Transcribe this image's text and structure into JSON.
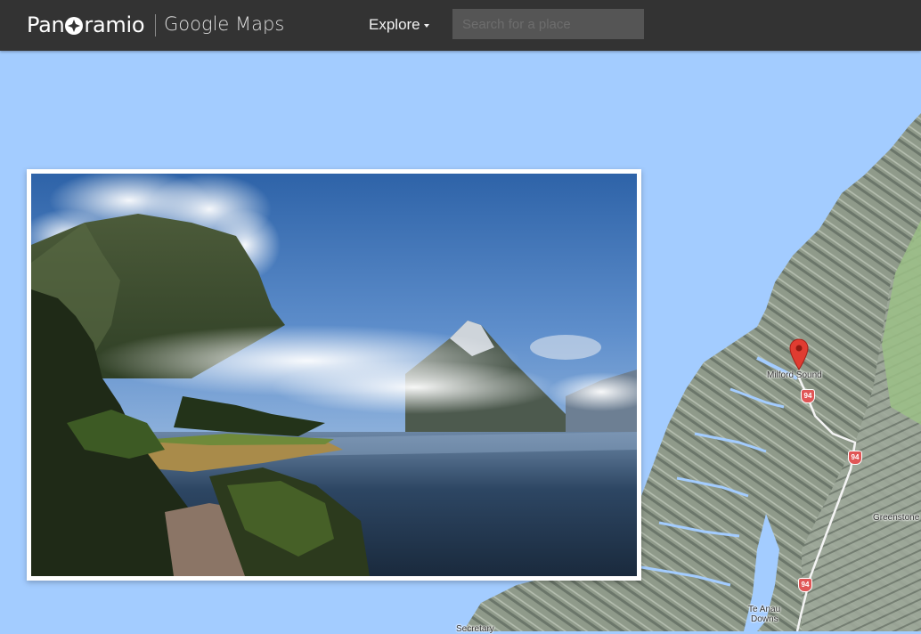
{
  "header": {
    "logo_text_left": "Pan",
    "logo_text_right": "ramio",
    "product_label": "Google Maps",
    "explore_label": "Explore",
    "search_placeholder": "Search for a place",
    "search_value": ""
  },
  "map": {
    "marker_label": "Milford Sound",
    "places": [
      "Greenstone",
      "Te Anau",
      "Downs",
      "Secretary"
    ],
    "route_shields": [
      "94",
      "94",
      "94"
    ]
  },
  "photo": {
    "icon": "photo-of-fiord-with-mountains"
  },
  "colors": {
    "topbar": "#333333",
    "water": "#a3ccff",
    "search_field": "#555555",
    "route_shield": "#e05656",
    "marker": "#e03c31"
  }
}
